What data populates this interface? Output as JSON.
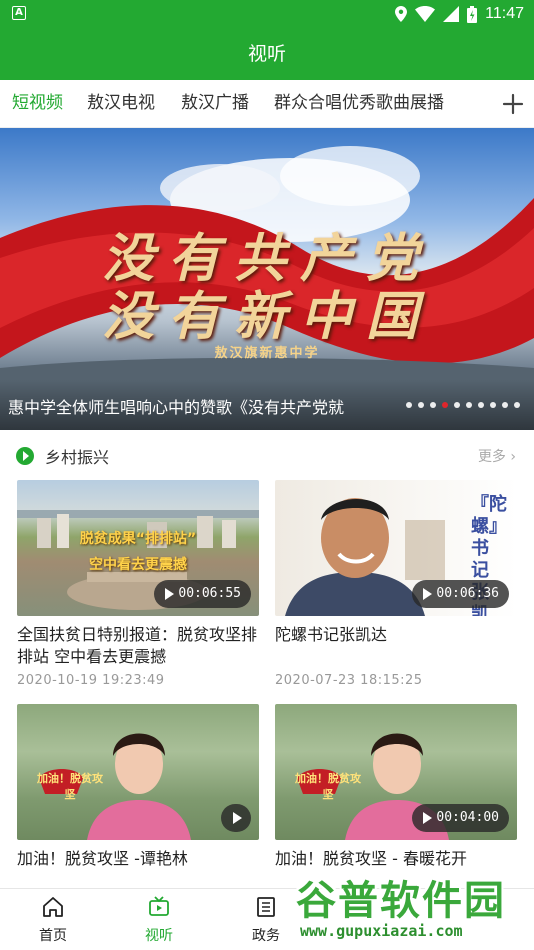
{
  "status_bar": {
    "time": "11:47",
    "left_badge": "A",
    "icons": [
      "location-icon",
      "wifi-icon",
      "signal-icon",
      "battery-icon"
    ]
  },
  "title": "视听",
  "tabs": [
    {
      "label": "短视频",
      "active": true
    },
    {
      "label": "敖汉电视",
      "active": false
    },
    {
      "label": "敖汉广播",
      "active": false
    },
    {
      "label": "群众合唱优秀歌曲展播",
      "active": false
    }
  ],
  "tab_add_icon": "plus-icon",
  "banner": {
    "calligraphy_line1": "没有共产党",
    "calligraphy_line2": "没有新中国",
    "sub_text": "敖汉旗新惠中学",
    "caption": "惠中学全体师生唱响心中的赞歌《没有共产党就",
    "slide_count": 10,
    "active_slide": 4
  },
  "section": {
    "title": "乡村振兴",
    "more": "更多 ›",
    "icon": "play-circle-icon"
  },
  "videos": [
    {
      "title": "全国扶贫日特别报道：脱贫攻坚排排站 空中看去更震撼",
      "time": "2020-10-19  19:23:49",
      "duration": "00:06:55",
      "overlay_line1": "脱贫成果“排排站”",
      "overlay_line2": "空中看去更震撼"
    },
    {
      "title": "陀螺书记张凯达",
      "time": "2020-07-23  18:15:25",
      "duration": "00:06:36",
      "overlay_text": "『陀螺』书记 张凯达"
    },
    {
      "title": "加油！脱贫攻坚  -谭艳林",
      "time": "",
      "duration": "",
      "overlay_text": "加油！脱贫攻坚"
    },
    {
      "title": "加油！脱贫攻坚  - 春暖花开",
      "time": "",
      "duration": "00:04:00",
      "overlay_text": "加油！脱贫攻坚"
    }
  ],
  "bottom_nav": [
    {
      "label": "首页",
      "icon": "home-icon",
      "active": false
    },
    {
      "label": "视听",
      "icon": "tv-icon",
      "active": true
    },
    {
      "label": "政务",
      "icon": "document-icon",
      "active": false
    }
  ],
  "watermark": {
    "title": "谷普软件园",
    "url": "www.gupuxiazai.com"
  },
  "colors": {
    "brand": "#23a932",
    "active_dot": "#e0262c"
  }
}
